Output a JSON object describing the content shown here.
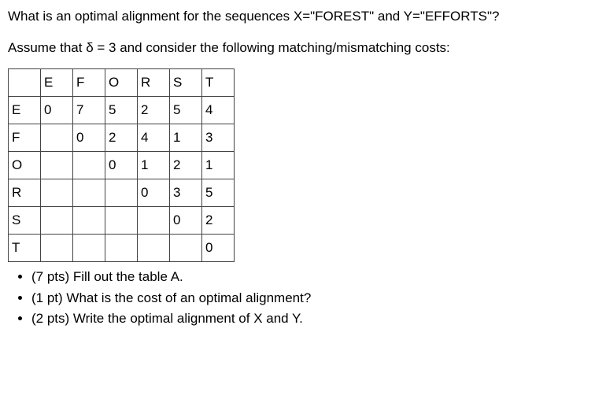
{
  "question1": "What is an optimal alignment for the sequences X=\"FOREST\" and Y=\"EFFORTS\"?",
  "question2": "Assume that δ = 3 and consider the following matching/mismatching costs:",
  "chart_data": {
    "type": "table",
    "col_headers": [
      "E",
      "F",
      "O",
      "R",
      "S",
      "T"
    ],
    "row_headers": [
      "E",
      "F",
      "O",
      "R",
      "S",
      "T"
    ],
    "rows": [
      [
        "0",
        "7",
        "5",
        "2",
        "5",
        "4"
      ],
      [
        "",
        "0",
        "2",
        "4",
        "1",
        "3"
      ],
      [
        "",
        "",
        "0",
        "1",
        "2",
        "1"
      ],
      [
        "",
        "",
        "",
        "0",
        "3",
        "5"
      ],
      [
        "",
        "",
        "",
        "",
        "0",
        "2"
      ],
      [
        "",
        "",
        "",
        "",
        "",
        "0"
      ]
    ]
  },
  "bullets": {
    "b1": "(7 pts) Fill out the table A.",
    "b2": "(1 pt) What is the cost of an optimal alignment?",
    "b3": "(2 pts) Write the optimal alignment of X and Y."
  }
}
